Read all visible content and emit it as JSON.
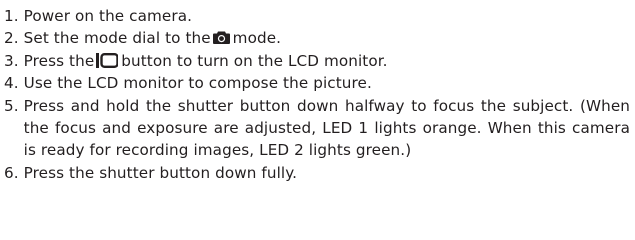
{
  "steps": [
    {
      "number": "1.",
      "text": "Power on the camera."
    },
    {
      "number": "2.",
      "before": "Set the mode dial to the",
      "icon": "camera-mode-icon",
      "after": "mode."
    },
    {
      "number": "3.",
      "before": "Press the",
      "icon": "lcd-monitor-button-icon",
      "after": "button to turn on the LCD monitor."
    },
    {
      "number": "4.",
      "text": "Use the LCD monitor to compose the picture."
    },
    {
      "number": "5.",
      "text": "Press and hold the shutter button down halfway to focus the subject. (When the focus and exposure are adjusted, LED 1 lights orange. When this camera is ready for recording images, LED 2 lights green.)"
    },
    {
      "number": "6.",
      "text": "Press the shutter button down fully."
    }
  ]
}
